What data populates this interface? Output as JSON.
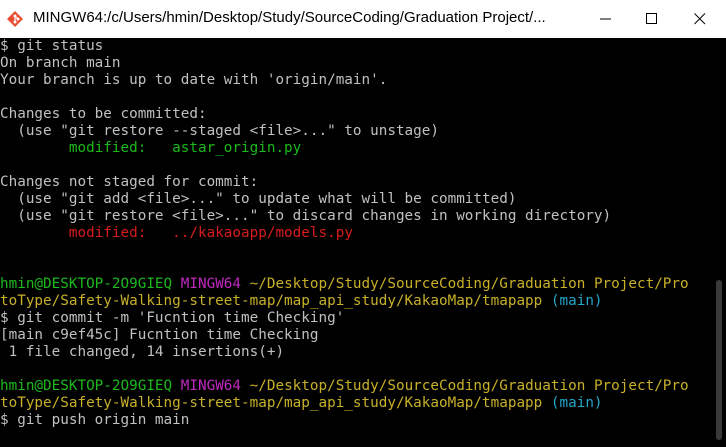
{
  "window": {
    "title": "MINGW64:/c/Users/hmin/Desktop/Study/SourceCoding/Graduation Project/..."
  },
  "terminal": {
    "lines": [
      [
        {
          "t": "$ git status",
          "c": "white"
        }
      ],
      [
        {
          "t": "On branch main",
          "c": "white"
        }
      ],
      [
        {
          "t": "Your branch is up to date with 'origin/main'.",
          "c": "white"
        }
      ],
      [
        {
          "t": "",
          "c": "white"
        }
      ],
      [
        {
          "t": "Changes to be committed:",
          "c": "white"
        }
      ],
      [
        {
          "t": "  (use \"git restore --staged <file>...\" to unstage)",
          "c": "white"
        }
      ],
      [
        {
          "t": "        ",
          "c": "white"
        },
        {
          "t": "modified:   astar_origin.py",
          "c": "green"
        }
      ],
      [
        {
          "t": "",
          "c": "white"
        }
      ],
      [
        {
          "t": "Changes not staged for commit:",
          "c": "white"
        }
      ],
      [
        {
          "t": "  (use \"git add <file>...\" to update what will be committed)",
          "c": "white"
        }
      ],
      [
        {
          "t": "  (use \"git restore <file>...\" to discard changes in working directory)",
          "c": "white"
        }
      ],
      [
        {
          "t": "        ",
          "c": "white"
        },
        {
          "t": "modified:   ../kakaoapp/models.py",
          "c": "red"
        }
      ],
      [
        {
          "t": "",
          "c": "white"
        }
      ],
      [
        {
          "t": "",
          "c": "white"
        }
      ],
      [
        {
          "t": "hmin@DESKTOP-2O9GIEQ ",
          "c": "green"
        },
        {
          "t": "MINGW64 ",
          "c": "magenta"
        },
        {
          "t": "~/Desktop/Study/SourceCoding/Graduation Project/Pro",
          "c": "yellow"
        }
      ],
      [
        {
          "t": "toType/Safety-Walking-street-map/map_api_study/KakaoMap/tmapapp",
          "c": "yellow"
        },
        {
          "t": " (main)",
          "c": "cyan"
        }
      ],
      [
        {
          "t": "$ git commit -m 'Fucntion time Checking'",
          "c": "white"
        }
      ],
      [
        {
          "t": "[main c9ef45c] Fucntion time Checking",
          "c": "white"
        }
      ],
      [
        {
          "t": " 1 file changed, 14 insertions(+)",
          "c": "white"
        }
      ],
      [
        {
          "t": "",
          "c": "white"
        }
      ],
      [
        {
          "t": "hmin@DESKTOP-2O9GIEQ ",
          "c": "green"
        },
        {
          "t": "MINGW64 ",
          "c": "magenta"
        },
        {
          "t": "~/Desktop/Study/SourceCoding/Graduation Project/Pro",
          "c": "yellow"
        }
      ],
      [
        {
          "t": "toType/Safety-Walking-street-map/map_api_study/KakaoMap/tmapapp",
          "c": "yellow"
        },
        {
          "t": " (main)",
          "c": "cyan"
        }
      ],
      [
        {
          "t": "$ git push origin main",
          "c": "white"
        }
      ]
    ]
  },
  "colors": {
    "background": "#000000",
    "text": "#c0c0c0",
    "green": "#1cb91c",
    "red": "#d81b1b",
    "magenta": "#c028c0",
    "yellow": "#c8b028",
    "cyan": "#23a6c8"
  }
}
